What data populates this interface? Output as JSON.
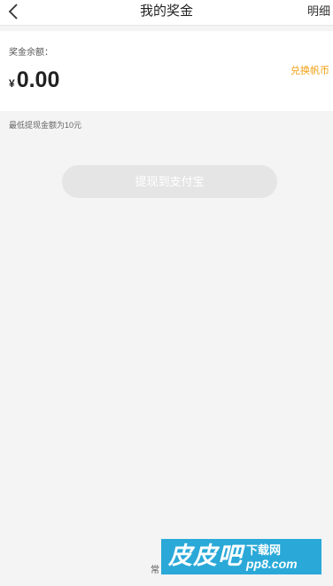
{
  "header": {
    "back_icon": "chevron-left-icon",
    "title": "我的奖金",
    "detail_label": "明细"
  },
  "balance": {
    "label": "奖金余额：",
    "currency": "¥",
    "amount": "0.00",
    "exchange_label": "兑换帆币"
  },
  "withdraw": {
    "min_note": "最低提现金额为10元",
    "button_label": "提现到支付宝"
  },
  "footer": {
    "text": "常"
  },
  "watermark": {
    "brand": "皮皮吧",
    "sub": "下载网",
    "domain": "pp8.com"
  },
  "colors": {
    "accent": "#f0a014",
    "background": "#f4f4f4",
    "button_disabled": "#e5e5e5",
    "watermark": "#2aa9d8"
  }
}
